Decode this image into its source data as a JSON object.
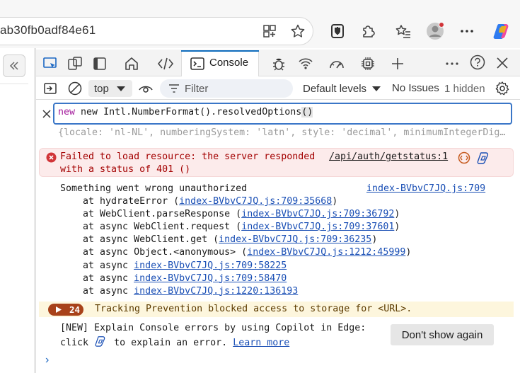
{
  "browser": {
    "address_text": "ab30fb0adf84e61"
  },
  "devtools": {
    "tabs": {
      "console_label": "Console"
    },
    "toolbar": {
      "context": "top",
      "filter_placeholder": "Filter",
      "levels": "Default levels",
      "issues": "No Issues",
      "hidden": "1 hidden"
    },
    "input": {
      "value_before": "new Intl.NumberFormat().resolvedOptions",
      "value_parens": "()",
      "eager_result": "{locale: 'nl-NL', numberingSystem: 'latn', style: 'decimal', minimumIntegerDig…"
    },
    "error": {
      "line1": "Failed to load resource: the server responded",
      "line2": "with a status of 401 ()",
      "source": "/api/auth/getstatus:1"
    },
    "log": {
      "message": "Something went wrong unauthorized",
      "source": "index-BVbvC7JQ.js:709",
      "stack": [
        {
          "prefix": "    at hydrateError (",
          "link": "index-BVbvC7JQ.js:709:35668",
          "suffix": ")"
        },
        {
          "prefix": "    at WebClient.parseResponse (",
          "link": "index-BVbvC7JQ.js:709:36792",
          "suffix": ")"
        },
        {
          "prefix": "    at async WebClient.request (",
          "link": "index-BVbvC7JQ.js:709:37601",
          "suffix": ")"
        },
        {
          "prefix": "    at async WebClient.get (",
          "link": "index-BVbvC7JQ.js:709:36235",
          "suffix": ")"
        },
        {
          "prefix": "    at async Object.<anonymous> (",
          "link": "index-BVbvC7JQ.js:1212:45999",
          "suffix": ")"
        },
        {
          "prefix": "    at async ",
          "link": "index-BVbvC7JQ.js:709:58225",
          "suffix": ""
        },
        {
          "prefix": "    at async ",
          "link": "index-BVbvC7JQ.js:709:58470",
          "suffix": ""
        },
        {
          "prefix": "    at async ",
          "link": "index-BVbvC7JQ.js:1220:136193",
          "suffix": ""
        }
      ]
    },
    "warning": {
      "count": "24",
      "text": "Tracking Prevention blocked access to storage for <URL>."
    },
    "copilot": {
      "line1": "[NEW] Explain Console errors by using Copilot in Edge:",
      "line2_before": "click",
      "line2_after": "to explain an error.",
      "learn_more": "Learn more",
      "dont_show": "Don't show again"
    },
    "prompt_caret": "›"
  }
}
